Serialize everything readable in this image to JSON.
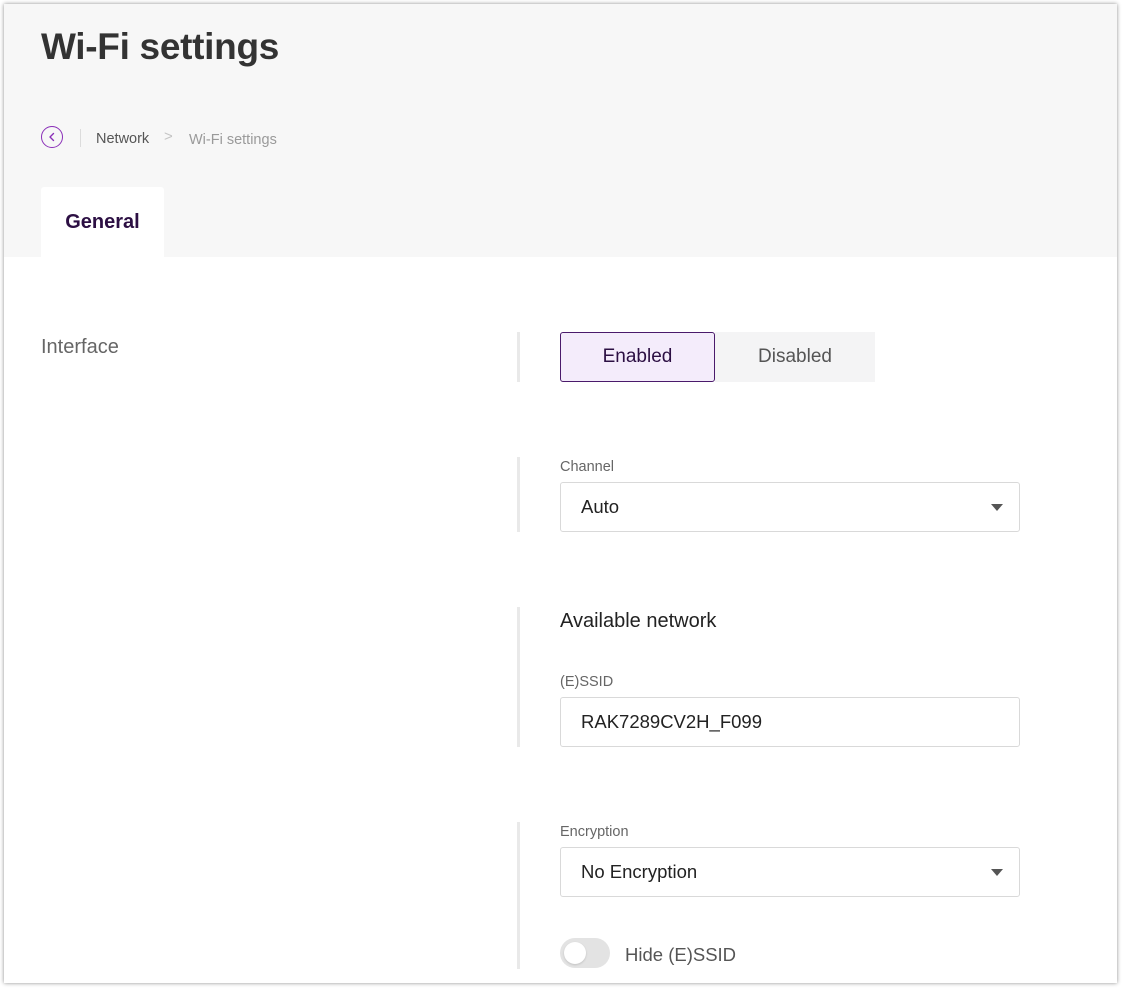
{
  "header": {
    "title": "Wi-Fi settings",
    "breadcrumb": {
      "items": [
        "Network"
      ],
      "separator": ">",
      "current": "Wi-Fi settings"
    }
  },
  "tabs": [
    {
      "label": "General",
      "active": true
    }
  ],
  "interface": {
    "label": "Interface",
    "options": [
      "Enabled",
      "Disabled"
    ],
    "selected": "Enabled"
  },
  "channel": {
    "label": "Channel",
    "value": "Auto"
  },
  "available_network": {
    "title": "Available network",
    "essid_label": "(E)SSID",
    "essid_value": "RAK7289CV2H_F099"
  },
  "encryption": {
    "label": "Encryption",
    "value": "No Encryption"
  },
  "hide_essid": {
    "label": "Hide (E)SSID",
    "enabled": false
  },
  "colors": {
    "accent": "#8a2fb8",
    "tab_text": "#2c0f43",
    "header_bg": "#f7f7f7",
    "selected_bg": "#f4ecfb"
  },
  "icons": {
    "back": "chevron-left-icon",
    "dropdown": "caret-down-icon"
  }
}
